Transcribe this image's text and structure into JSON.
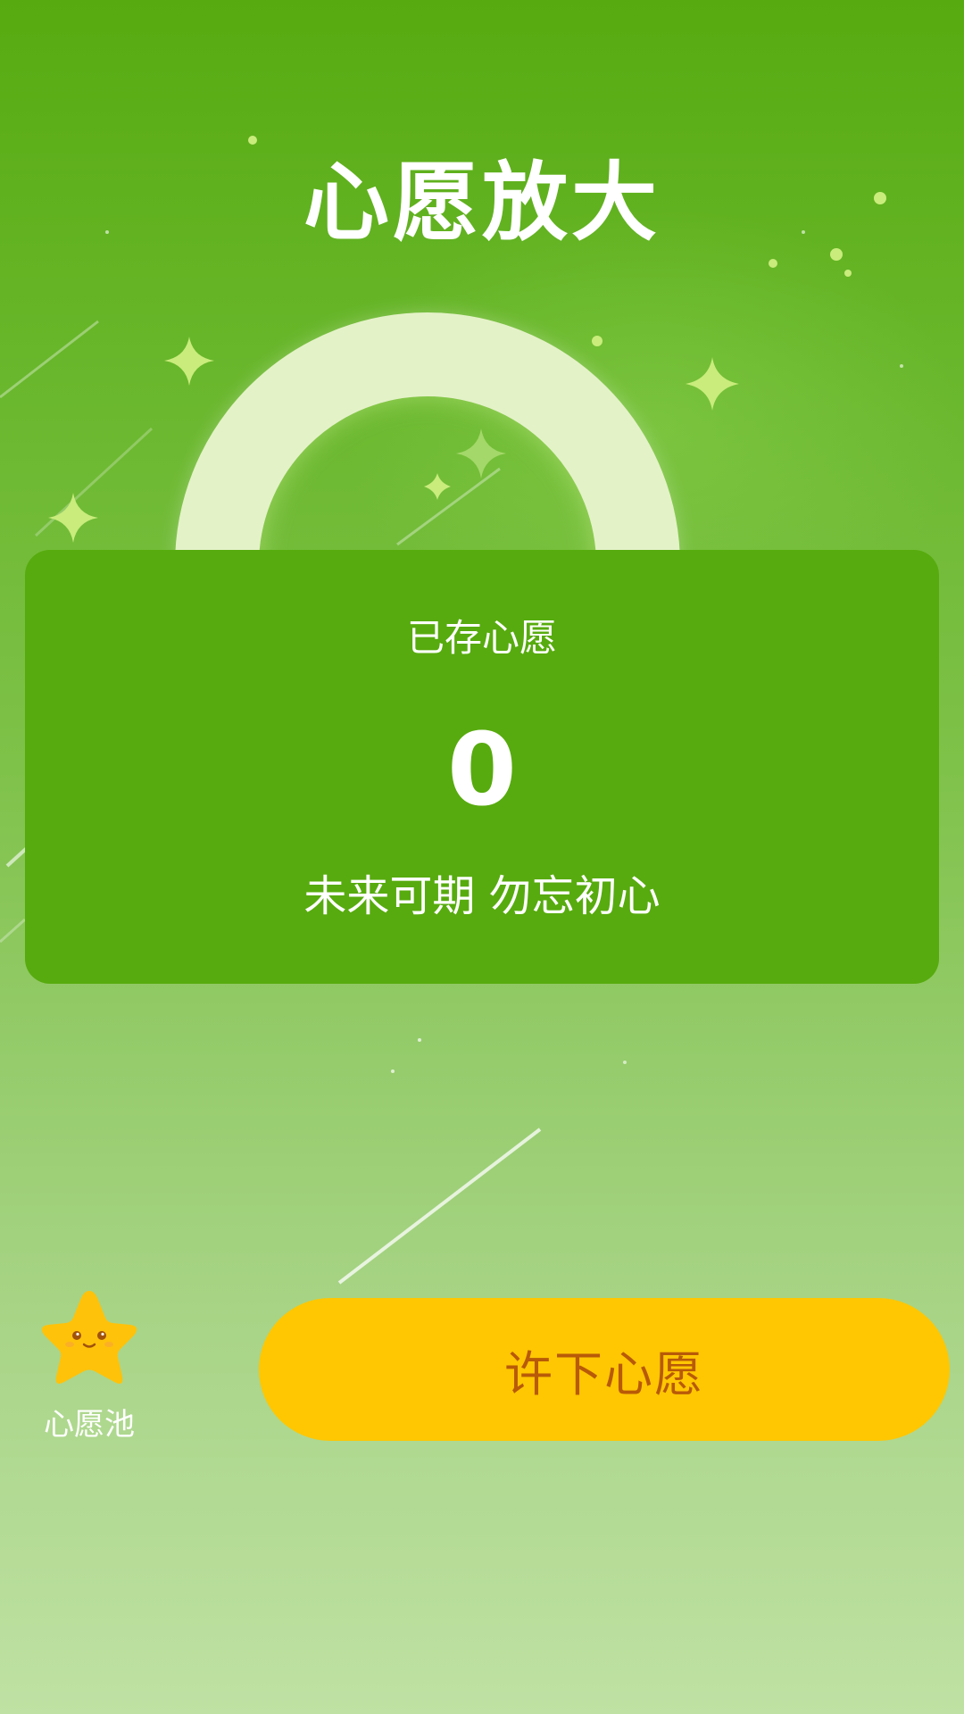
{
  "header": {
    "title": "心愿放大"
  },
  "wish_card": {
    "label": "已存心愿",
    "count": "0",
    "slogan": "未来可期 勿忘初心"
  },
  "wish_pool": {
    "label": "心愿池",
    "icon": "star-mascot-icon"
  },
  "actions": {
    "make_wish_label": "许下心愿"
  },
  "colors": {
    "background_top": "#57ab10",
    "background_bottom": "#bfe1a3",
    "card": "#57ab0e",
    "button": "#ffc702",
    "button_text": "#b85a08",
    "star_mascot": "#ffc20a"
  }
}
